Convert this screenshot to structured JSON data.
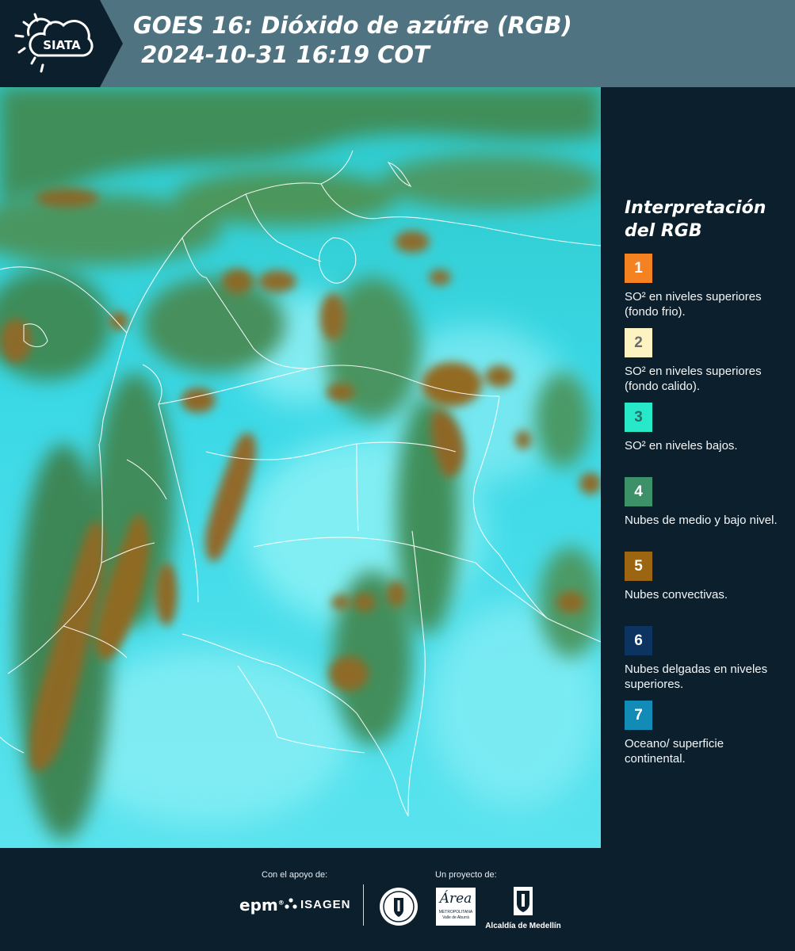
{
  "header": {
    "brand": "SIATA",
    "title_line1": "GOES 16: Dióxido de azúfre (RGB)",
    "title_line2": " 2024-10-31 16:19 COT"
  },
  "legend": {
    "title_line1": "Interpretación",
    "title_line2": "del RGB",
    "items": [
      {
        "number": "1",
        "label": "SO² en niveles superiores (fondo frio).",
        "color": "#f58220",
        "text_color": "#ffffff"
      },
      {
        "number": "2",
        "label": "SO² en niveles superiores (fondo calido).",
        "color": "#fdf3c2",
        "text_color": "#6b6b6b"
      },
      {
        "number": "3",
        "label": "SO² en niveles bajos.",
        "color": "#27e8c9",
        "text_color": "#2b6e66"
      },
      {
        "number": "4",
        "label": "Nubes de medio y bajo nivel.",
        "color": "#3c9168",
        "text_color": "#ffffff"
      },
      {
        "number": "5",
        "label": "Nubes convectivas.",
        "color": "#9b6511",
        "text_color": "#ffffff"
      },
      {
        "number": "6",
        "label": "Nubes delgadas en niveles superiores.",
        "color": "#0d3361",
        "text_color": "#ffffff"
      },
      {
        "number": "7",
        "label": "Oceano/ superficie continental.",
        "color": "#128bb7",
        "text_color": "#ffffff"
      }
    ]
  },
  "footer": {
    "support_label": "Con el apoyo de:",
    "project_label": "Un proyecto de:",
    "epm": "epm",
    "isagen": "ISAGEN",
    "area_text": "Área",
    "area_sub1": "METROPOLITANA",
    "area_sub2": "Valle de Aburrá",
    "alcaldia": "Alcaldía de Medellín"
  },
  "colors": {
    "header_bg": "#4f7381",
    "page_bg": "#0c1f2c",
    "cyan_surface": "#33dde8",
    "cloud_green": "#3f8e5a",
    "cloud_brown": "#8c6a25",
    "border_line": "#ffffff"
  }
}
